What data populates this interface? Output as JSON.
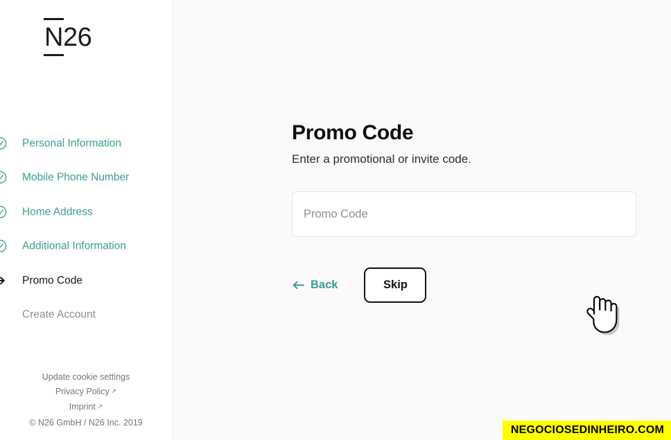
{
  "colors": {
    "accent_teal": "#3a9e92",
    "text_dark": "#15151a",
    "text_muted": "#8b9096",
    "sidebar_bg": "#ffffff",
    "main_bg": "#fafafa",
    "border": "#e3e4e8",
    "watermark_bg": "#ffff00",
    "watermark_fg": "#000000"
  },
  "sidebar": {
    "logo": {
      "n": "N",
      "rest": "26",
      "alt": "N26"
    },
    "steps": [
      {
        "label": "Personal Information",
        "state": "done",
        "icon": "check-circle-icon"
      },
      {
        "label": "Mobile Phone Number",
        "state": "done",
        "icon": "check-circle-icon"
      },
      {
        "label": "Home Address",
        "state": "done",
        "icon": "check-circle-icon"
      },
      {
        "label": "Additional Information",
        "state": "done",
        "icon": "check-circle-icon"
      },
      {
        "label": "Promo Code",
        "state": "active",
        "icon": "arrow-right-icon"
      },
      {
        "label": "Create Account",
        "state": "todo",
        "icon": "none"
      }
    ],
    "footer": {
      "cookie_settings": "Update cookie settings",
      "privacy_policy": "Privacy Policy",
      "imprint": "Imprint",
      "external_arrow": "↗",
      "copyright": "© N26 GmbH / N26 Inc. 2019"
    }
  },
  "main": {
    "title": "Promo Code",
    "subtitle": "Enter a promotional or invite code.",
    "promo_input": {
      "value": "",
      "placeholder": "Promo Code"
    },
    "back_label": "Back",
    "skip_label": "Skip"
  },
  "watermark": {
    "text": "NEGOCIOSEDINHEIRO.COM"
  }
}
